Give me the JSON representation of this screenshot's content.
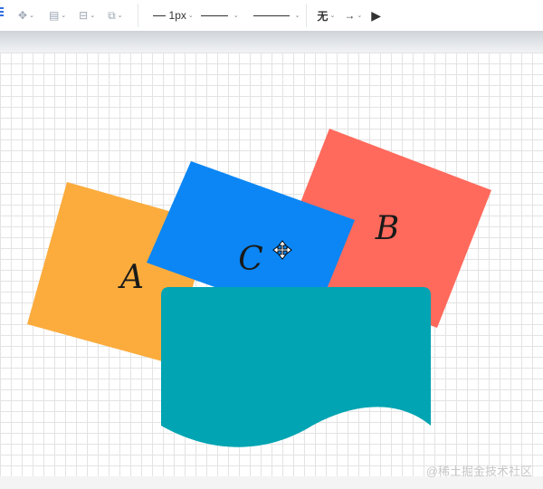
{
  "toolbar": {
    "stroke_width": "1px",
    "arrow_style": "无"
  },
  "shapes": [
    {
      "name": "A",
      "color": "#fbac3d"
    },
    {
      "name": "B",
      "color": "#ff6a5c"
    },
    {
      "name": "C",
      "color": "#0b86f4"
    },
    {
      "name": "document",
      "color": "#00a4b2"
    }
  ],
  "watermark": "@稀土掘金技术社区"
}
